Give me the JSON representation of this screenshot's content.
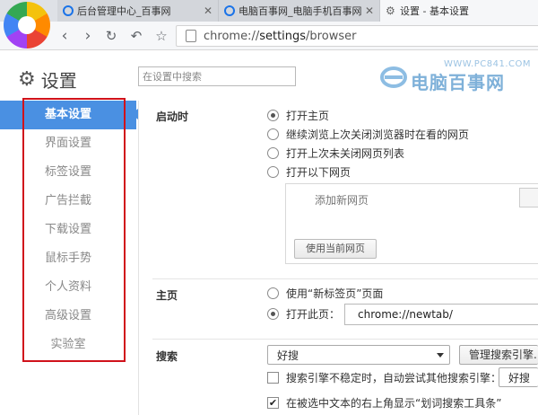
{
  "browser": {
    "tabs": [
      {
        "title": "后台管理中心_百事网",
        "icon": "globe-icon",
        "active": false
      },
      {
        "title": "电脑百事网_电脑手机百事网",
        "icon": "globe-icon",
        "active": false
      },
      {
        "title": "设置 - 基本设置",
        "icon": "gear-icon",
        "active": true
      }
    ],
    "address_bar": {
      "url_prefix": "chrome://",
      "url_main": "settings",
      "url_suffix": "/browser"
    }
  },
  "header": {
    "title": "设置",
    "search_placeholder": "在设置中搜索"
  },
  "watermark": {
    "url": "WWW.PC841.COM",
    "name": "电脑百事网"
  },
  "sidebar": {
    "items": [
      {
        "label": "基本设置",
        "active": true
      },
      {
        "label": "界面设置"
      },
      {
        "label": "标签设置"
      },
      {
        "label": "广告拦截"
      },
      {
        "label": "下载设置"
      },
      {
        "label": "鼠标手势"
      },
      {
        "label": "个人资料"
      },
      {
        "label": "高级设置"
      },
      {
        "label": "实验室"
      }
    ]
  },
  "startup": {
    "label": "启动时",
    "options": [
      {
        "label": "打开主页",
        "selected": true
      },
      {
        "label": "继续浏览上次关闭浏览器时在看的网页",
        "selected": false
      },
      {
        "label": "打开上次未关闭网页列表",
        "selected": false
      },
      {
        "label": "打开以下网页",
        "selected": false
      }
    ],
    "add_new_page": "添加新网页",
    "use_current_button": "使用当前网页"
  },
  "homepage": {
    "label": "主页",
    "options": [
      {
        "label": "使用“新标签页”页面",
        "selected": false
      },
      {
        "label": "打开此页：",
        "selected": true
      }
    ],
    "url": "chrome://newtab/"
  },
  "search": {
    "label": "搜索",
    "engine": "好搜",
    "manage_button": "管理搜索引擎...",
    "fallback_label": "搜索引擎不稳定时，自动尝试其他搜索引擎：",
    "fallback_checked": false,
    "fallback_engine": "好搜",
    "toolbar_label": "在被选中文本的右上角显示“划词搜索工具条”",
    "toolbar_checked": true
  }
}
